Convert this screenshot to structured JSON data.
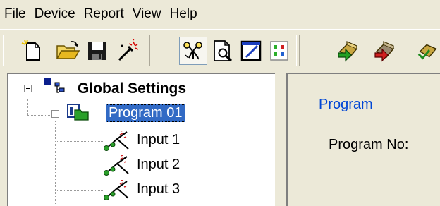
{
  "menu": {
    "items": [
      "File",
      "Device",
      "Report",
      "View",
      "Help"
    ]
  },
  "toolbar": {
    "buttons": [
      {
        "icon": "new-file-icon"
      },
      {
        "icon": "open-folder-icon"
      },
      {
        "icon": "save-disk-icon"
      },
      {
        "icon": "magic-wand-icon"
      },
      {
        "icon": "network-diagram-icon",
        "pressed": true
      },
      {
        "icon": "print-preview-icon"
      },
      {
        "icon": "edit-slash-icon"
      },
      {
        "icon": "settings-grid-icon"
      },
      {
        "icon": "device-green-arrow-icon"
      },
      {
        "icon": "device-red-arrow-icon"
      },
      {
        "icon": "device-check-icon"
      }
    ]
  },
  "tree": {
    "root": {
      "label": "Global Settings",
      "icon": "global-settings-icon"
    },
    "program": {
      "label": "Program 01",
      "icon": "program-folder-icon",
      "selected": true
    },
    "inputs": [
      {
        "label": "Input 1",
        "icon": "input-node-icon"
      },
      {
        "label": "Input 2",
        "icon": "input-node-icon"
      },
      {
        "label": "Input 3",
        "icon": "input-node-icon"
      }
    ]
  },
  "details": {
    "heading": "Program",
    "program_no_label": "Program No:"
  },
  "colors": {
    "window_bg": "#ece9d8",
    "selection": "#316ac5",
    "heading": "#0046d5"
  }
}
